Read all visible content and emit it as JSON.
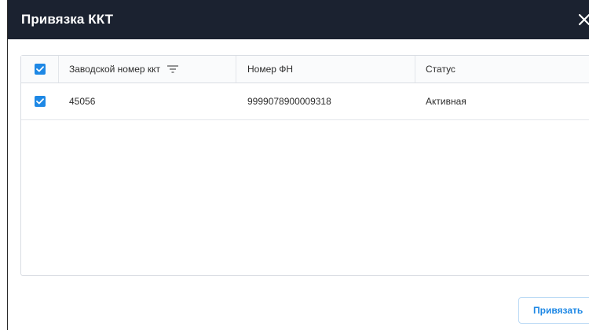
{
  "dialog": {
    "title": "Привязка ККТ"
  },
  "table": {
    "columns": [
      {
        "label": "Заводской номер ккт",
        "sortable": true
      },
      {
        "label": "Номер ФН"
      },
      {
        "label": "Статус"
      }
    ],
    "header_checked": true,
    "rows": [
      {
        "checked": true,
        "serial": "45056",
        "fn_number": "9999078900009318",
        "status": "Активная"
      }
    ]
  },
  "footer": {
    "bind_label": "Привязать"
  },
  "colors": {
    "header_bg": "#1b2230",
    "accent": "#1e88e5"
  },
  "icons": {
    "close": "close-icon",
    "sort": "sort-icon",
    "check": "checkmark-icon"
  }
}
